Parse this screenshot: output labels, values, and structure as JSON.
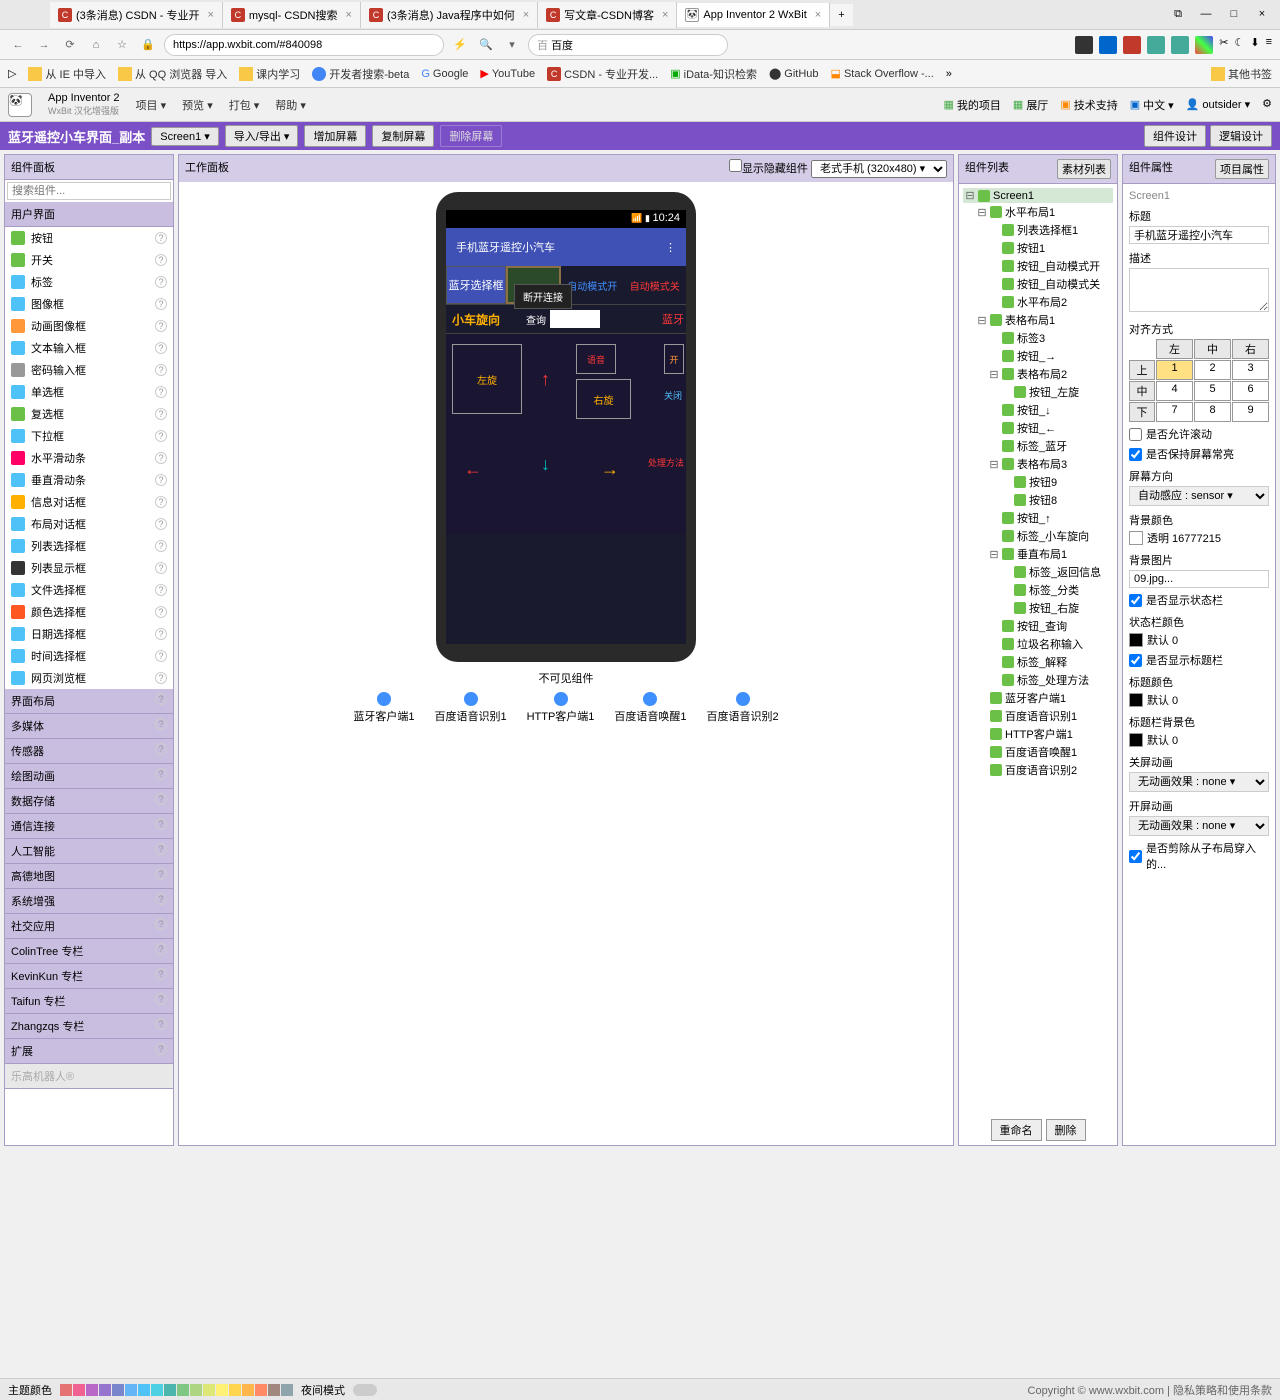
{
  "tabs": [
    {
      "label": "(3条消息) CSDN - 专业开",
      "icon": "C"
    },
    {
      "label": "mysql- CSDN搜索",
      "icon": "C"
    },
    {
      "label": "(3条消息) Java程序中如何",
      "icon": "C"
    },
    {
      "label": "写文章-CSDN博客",
      "icon": "C"
    },
    {
      "label": "App Inventor 2 WxBit",
      "icon": "🐼",
      "active": true
    }
  ],
  "url": "https://app.wxbit.com/#840098",
  "search_engine": "百度",
  "bookmarks": [
    "从 IE 中导入",
    "从 QQ 浏览器 导入",
    "课内学习",
    "开发者搜索-beta",
    "Google",
    "YouTube",
    "CSDN - 专业开发...",
    "iData-知识检索",
    "GitHub",
    "Stack Overflow -...",
    "其他书签"
  ],
  "app": {
    "title": "App Inventor 2",
    "subtitle": "WxBit 汉化增强版"
  },
  "menus": [
    "项目 ▾",
    "预览 ▾",
    "打包 ▾",
    "帮助 ▾"
  ],
  "hdr_right": [
    "我的项目",
    "展厅",
    "技术支持",
    "中文 ▾",
    "outsider ▾"
  ],
  "project": "蓝牙遥控小车界面_副本",
  "pb_buttons": {
    "screen": "Screen1 ▾",
    "import": "导入/导出 ▾",
    "add": "增加屏幕",
    "copy": "复制屏幕",
    "del": "删除屏幕",
    "design": "组件设计",
    "logic": "逻辑设计"
  },
  "palette": {
    "hdr": "组件面板",
    "search": "搜索组件...",
    "cat": "用户界面",
    "items": [
      "按钮",
      "开关",
      "标签",
      "图像框",
      "动画图像框",
      "文本输入框",
      "密码输入框",
      "单选框",
      "复选框",
      "下拉框",
      "水平滑动条",
      "垂直滑动条",
      "信息对话框",
      "布局对话框",
      "列表选择框",
      "列表显示框",
      "文件选择框",
      "颜色选择框",
      "日期选择框",
      "时间选择框",
      "网页浏览框"
    ],
    "cats": [
      "界面布局",
      "多媒体",
      "传感器",
      "绘图动画",
      "数据存储",
      "通信连接",
      "人工智能",
      "高德地图",
      "系统增强",
      "社交应用",
      "ColinTree 专栏",
      "KevinKun 专栏",
      "Taifun 专栏",
      "Zhangzqs 专栏",
      "扩展"
    ],
    "disabled": "乐高机器人®"
  },
  "workspace": {
    "hdr": "工作面板",
    "hide": "显示隐藏组件",
    "device": "老式手机 (320x480) ▾",
    "time": "10:24",
    "app_title": "手机蓝牙遥控小汽车",
    "bt_select": "蓝牙选择框",
    "mode_on": "自动模式开",
    "mode_off": "自动模式关",
    "disconnect": "断开连接",
    "spin": "小车旋向",
    "query": "查询",
    "bt": "蓝牙",
    "left_spin": "左旋",
    "right_spin": "右旋",
    "voice": "语音",
    "switch": "开",
    "close": "关闭",
    "method": "处理方法",
    "invisible": "不可见组件",
    "inv_items": [
      "蓝牙客户端1",
      "百度语音识别1",
      "HTTP客户端1",
      "百度语音唤醒1",
      "百度语音识别2"
    ]
  },
  "tree": {
    "hdr": "组件列表",
    "material": "素材列表",
    "rename": "重命名",
    "delete": "删除",
    "nodes": [
      {
        "l": "Screen1",
        "d": 0,
        "e": "⊟",
        "sel": true
      },
      {
        "l": "水平布局1",
        "d": 1,
        "e": "⊟"
      },
      {
        "l": "列表选择框1",
        "d": 2
      },
      {
        "l": "按钮1",
        "d": 2
      },
      {
        "l": "按钮_自动模式开",
        "d": 2
      },
      {
        "l": "按钮_自动模式关",
        "d": 2
      },
      {
        "l": "水平布局2",
        "d": 2
      },
      {
        "l": "表格布局1",
        "d": 1,
        "e": "⊟"
      },
      {
        "l": "标签3",
        "d": 2
      },
      {
        "l": "按钮_→",
        "d": 2
      },
      {
        "l": "表格布局2",
        "d": 2,
        "e": "⊟"
      },
      {
        "l": "按钮_左旋",
        "d": 3
      },
      {
        "l": "按钮_↓",
        "d": 2
      },
      {
        "l": "按钮_←",
        "d": 2
      },
      {
        "l": "标签_蓝牙",
        "d": 2
      },
      {
        "l": "表格布局3",
        "d": 2,
        "e": "⊟"
      },
      {
        "l": "按钮9",
        "d": 3
      },
      {
        "l": "按钮8",
        "d": 3
      },
      {
        "l": "按钮_↑",
        "d": 2
      },
      {
        "l": "标签_小车旋向",
        "d": 2
      },
      {
        "l": "垂直布局1",
        "d": 2,
        "e": "⊟"
      },
      {
        "l": "标签_返回信息",
        "d": 3
      },
      {
        "l": "标签_分类",
        "d": 3
      },
      {
        "l": "按钮_右旋",
        "d": 3
      },
      {
        "l": "按钮_查询",
        "d": 2
      },
      {
        "l": "垃圾名称输入",
        "d": 2
      },
      {
        "l": "标签_解释",
        "d": 2
      },
      {
        "l": "标签_处理方法",
        "d": 2
      },
      {
        "l": "蓝牙客户端1",
        "d": 1,
        "i": "bt"
      },
      {
        "l": "百度语音识别1",
        "d": 1,
        "i": "mic"
      },
      {
        "l": "HTTP客户端1",
        "d": 1,
        "i": "http"
      },
      {
        "l": "百度语音唤醒1",
        "d": 1,
        "i": "mic"
      },
      {
        "l": "百度语音识别2",
        "d": 1,
        "i": "mic"
      }
    ]
  },
  "props": {
    "hdr": "组件属性",
    "proj": "项目属性",
    "screen": "Screen1",
    "title_lbl": "标题",
    "title_val": "手机蓝牙遥控小汽车",
    "desc_lbl": "描述",
    "align_lbl": "对齐方式",
    "align_cols": [
      "左",
      "中",
      "右"
    ],
    "align_rows": [
      "上",
      "中",
      "下"
    ],
    "align_vals": [
      [
        "1",
        "2",
        "3"
      ],
      [
        "4",
        "5",
        "6"
      ],
      [
        "7",
        "8",
        "9"
      ]
    ],
    "scroll": "是否允许滚动",
    "keepon": "是否保持屏幕常亮",
    "orient_lbl": "屏幕方向",
    "orient_val": "自动感应 : sensor ▾",
    "bgcolor_lbl": "背景颜色",
    "bgcolor_val": "透明  16777215",
    "bgimg_lbl": "背景图片",
    "bgimg_val": "09.jpg...",
    "showstatus": "是否显示状态栏",
    "statuscolor_lbl": "状态栏颜色",
    "statuscolor_val": "默认  0",
    "showtitle": "是否显示标题栏",
    "titlecolor_lbl": "标题颜色",
    "titlecolor_val": "默认  0",
    "titlebg_lbl": "标题栏背景色",
    "titlebg_val": "默认  0",
    "closeanim_lbl": "关屏动画",
    "closeanim_val": "无动画效果 : none ▾",
    "openanim_lbl": "开屏动画",
    "openanim_val": "无动画效果 : none ▾",
    "clip": "是否剪除从子布局穿入的..."
  },
  "footer": {
    "theme": "主题颜色",
    "night": "夜间模式",
    "copyright": "Copyright © www.wxbit.com | 隐私策略和使用条款"
  }
}
